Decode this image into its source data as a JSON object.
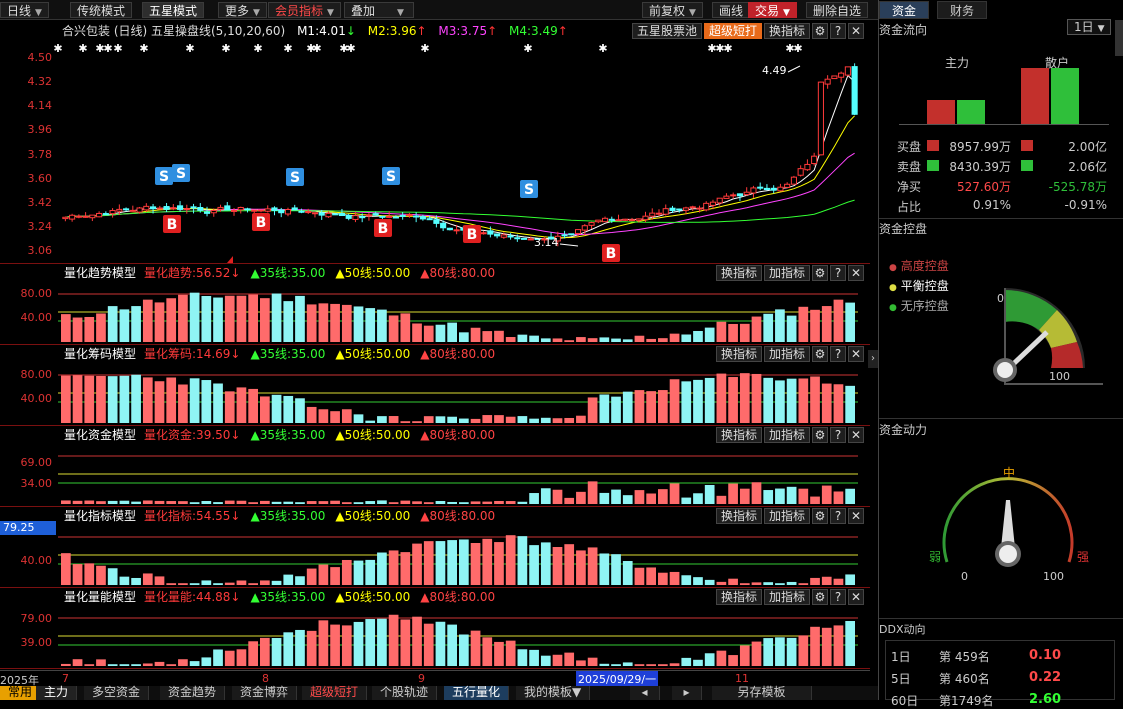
{
  "toolbar": {
    "items": [
      "日线",
      "传统模式",
      "五星模式",
      "更多",
      "会员指标",
      "叠加"
    ],
    "right_items": [
      "前复权",
      "画线",
      "交易",
      "删除自选"
    ]
  },
  "main": {
    "stock_title": "合兴包装 (日线) 五星操盘线(5,10,20,60)",
    "m1": "M1:4.01",
    "m2": "M2:3.96",
    "m3": "M3:3.75",
    "m4": "M4:3.49",
    "buttons": [
      "五星股票池",
      "超级短打",
      "换指标"
    ],
    "y_labels": [
      "4.50",
      "4.32",
      "4.14",
      "3.96",
      "3.78",
      "3.60",
      "3.42",
      "3.24",
      "3.06"
    ],
    "high_label": "4.49",
    "low_label": "3.14",
    "highlight_value": "79.25"
  },
  "chart_data": {
    "type": "candlestick",
    "title": "合兴包装 (日线) 五星操盘线(5,10,20,60)",
    "ylim": [
      3.0,
      4.6
    ],
    "ma_lines": {
      "M1": 4.01,
      "M2": 3.96,
      "M3": 3.75,
      "M4": 3.49
    },
    "high": 4.49,
    "low": 3.14,
    "x_ticks": [
      "7",
      "8",
      "9",
      "2025/09/29/一",
      "11"
    ],
    "year_label": "2025年",
    "sell_signal_count": 6,
    "buy_signal_count": 5
  },
  "indicators": [
    {
      "name": "量化趋势模型",
      "value_label": "量化趋势:56.52",
      "arrow": "↓",
      "l35": "35线:35.00",
      "l50": "50线:50.00",
      "l80": "80线:80.00",
      "ylabels": [
        "80.00",
        "40.00"
      ],
      "seed": 11
    },
    {
      "name": "量化筹码模型",
      "value_label": "量化筹码:14.69",
      "arrow": "↓",
      "l35": "35线:35.00",
      "l50": "50线:50.00",
      "l80": "80线:80.00",
      "ylabels": [
        "80.00",
        "40.00"
      ],
      "seed": 23
    },
    {
      "name": "量化资金模型",
      "value_label": "量化资金:39.50",
      "arrow": "↓",
      "l35": "35线:35.00",
      "l50": "50线:50.00",
      "l80": "80线:80.00",
      "ylabels": [
        "69.00",
        "34.00"
      ],
      "seed": 37
    },
    {
      "name": "量化指标模型",
      "value_label": "量化指标:54.55",
      "arrow": "↓",
      "l35": "35线:35.00",
      "l50": "50线:50.00",
      "l80": "80线:80.00",
      "ylabels": [
        "40.00"
      ],
      "seed": 41
    },
    {
      "name": "量化量能模型",
      "value_label": "量化量能:44.88",
      "arrow": "↓",
      "l35": "35线:35.00",
      "l50": "50线:50.00",
      "l80": "80线:80.00",
      "ylabels": [
        "79.00",
        "39.00"
      ],
      "seed": 53
    }
  ],
  "indicator_buttons": [
    "换指标",
    "加指标"
  ],
  "bottom_tabs": [
    "常用",
    "主力",
    "多空资金",
    "资金趋势",
    "资金博弈",
    "超级短打",
    "个股轨迹",
    "五行量化",
    "我的模板▼",
    "另存模板"
  ],
  "right": {
    "tabs": [
      "资金",
      "财务"
    ],
    "period": "1日",
    "flow_title": "资金流向",
    "main_force": "主力",
    "retail": "散户",
    "rows": [
      {
        "label": "买盘",
        "v1": "8957.99万",
        "v2": "2.00亿"
      },
      {
        "label": "卖盘",
        "v1": "8430.39万",
        "v2": "2.06亿"
      },
      {
        "label": "净买",
        "v1": "527.60万",
        "v2": "-525.78万"
      },
      {
        "label": "占比",
        "v1": "0.91%",
        "v2": "-0.91%"
      }
    ],
    "control_title": "资金控盘",
    "control_items": [
      "高度控盘",
      "平衡控盘",
      "无序控盘"
    ],
    "gauge1_min": "0",
    "gauge1_max": "100",
    "power_title": "资金动力",
    "gauge2_mid": "中",
    "gauge2_left": "弱",
    "gauge2_right": "强",
    "gauge2_min": "0",
    "gauge2_max": "100",
    "ddx_title": "DDX动向",
    "ddx_rows": [
      {
        "period": "1日",
        "rank": "第 459名",
        "value": "0.10"
      },
      {
        "period": "5日",
        "rank": "第 460名",
        "value": "0.22"
      },
      {
        "period": "60日",
        "rank": "第1749名",
        "value": "2.60"
      }
    ]
  },
  "colors": {
    "up": "#ff3a3a",
    "down": "#54ffff",
    "bg": "#000000"
  }
}
